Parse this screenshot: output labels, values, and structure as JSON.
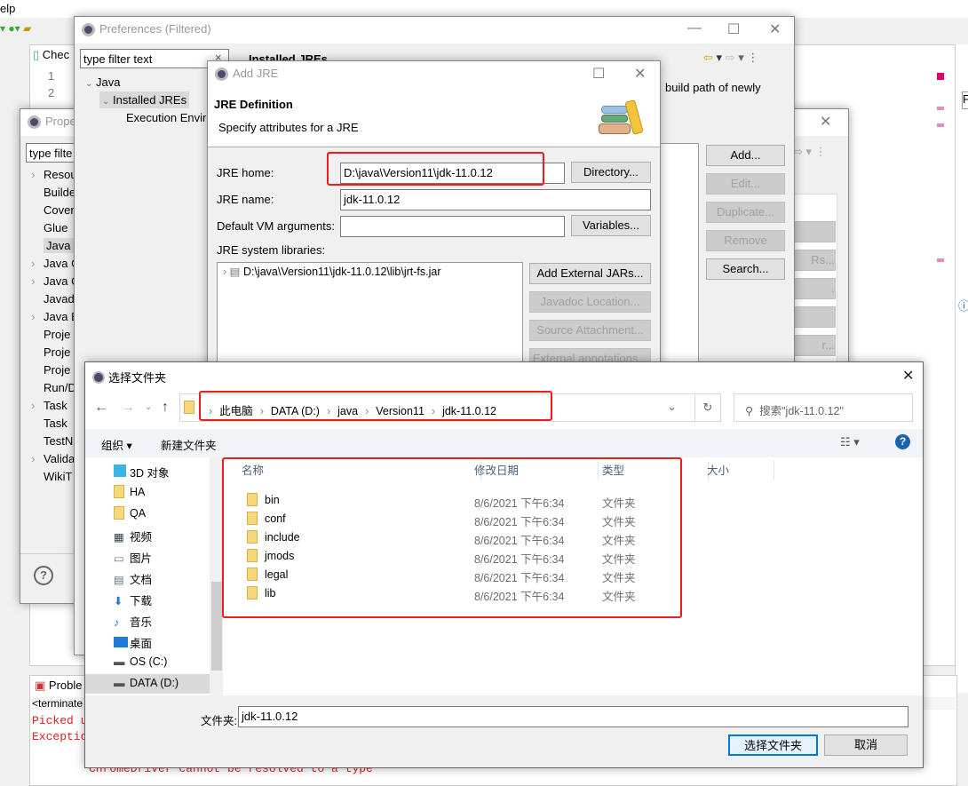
{
  "eclipse": {
    "menu_fragment": "elp",
    "editor_tab": "Chec",
    "line_numbers": [
      "1",
      "2"
    ],
    "problems_tab": "Proble",
    "console_header": "<terminate",
    "console_lines": [
      "Picked u",
      "Exceptio"
    ],
    "console_error": "ChromeDriver cannot be resolved to a type",
    "right_filter": "F"
  },
  "properties": {
    "title": "Prope",
    "filter": "type filte",
    "items": [
      {
        "label": "Resou",
        "arrow": true
      },
      {
        "label": "Builde"
      },
      {
        "label": "Cover"
      },
      {
        "label": "Glue"
      },
      {
        "label": "Java B",
        "selected": true
      },
      {
        "label": "Java C",
        "arrow": true
      },
      {
        "label": "Java C",
        "arrow": true
      },
      {
        "label": "Javad"
      },
      {
        "label": "Java E",
        "arrow": true
      },
      {
        "label": "Proje"
      },
      {
        "label": "Proje"
      },
      {
        "label": "Proje"
      },
      {
        "label": "Run/D"
      },
      {
        "label": "Task",
        "arrow": true
      },
      {
        "label": "Task"
      },
      {
        "label": "TestN"
      },
      {
        "label": "Valida",
        "arrow": true
      },
      {
        "label": "WikiT"
      }
    ],
    "right_buttons": [
      "",
      "Rs...",
      ".",
      "",
      "r..."
    ]
  },
  "preferences": {
    "title": "Preferences (Filtered)",
    "filter": "type filter text",
    "tree": {
      "java": "Java",
      "installed": "Installed JREs",
      "exec": "Execution Enviro"
    },
    "page_title": "Installed JREs",
    "description": "build path of newly",
    "buttons": {
      "add": "Add...",
      "edit": "Edit...",
      "duplicate": "Duplicate...",
      "remove": "Remove",
      "search": "Search..."
    }
  },
  "add_jre": {
    "title": "Add JRE",
    "header": "JRE Definition",
    "subheader": "Specify attributes for a JRE",
    "home_label": "JRE home:",
    "home_value": "D:\\java\\Version11\\jdk-11.0.12",
    "directory": "Directory...",
    "name_label": "JRE name:",
    "name_value": "jdk-11.0.12",
    "vm_label": "Default VM arguments:",
    "vm_value": "",
    "variables": "Variables...",
    "libs_label": "JRE system libraries:",
    "lib_item": "D:\\java\\Version11\\jdk-11.0.12\\lib\\jrt-fs.jar",
    "lib_buttons": {
      "add_ext": "Add External JARs...",
      "javadoc": "Javadoc Location...",
      "source": "Source Attachment...",
      "external": "External annotations..."
    }
  },
  "folder_dialog": {
    "title": "选择文件夹",
    "breadcrumb": [
      "此电脑",
      "DATA (D:)",
      "java",
      "Version11",
      "jdk-11.0.12"
    ],
    "search_placeholder": "搜索\"jdk-11.0.12\"",
    "organize": "组织 ▾",
    "new_folder": "新建文件夹",
    "nav": [
      {
        "label": "3D 对象",
        "icon": "cube"
      },
      {
        "label": "HA",
        "icon": "user-folder"
      },
      {
        "label": "QA",
        "icon": "folder"
      },
      {
        "label": "视频",
        "icon": "video"
      },
      {
        "label": "图片",
        "icon": "picture"
      },
      {
        "label": "文档",
        "icon": "document"
      },
      {
        "label": "下载",
        "icon": "download"
      },
      {
        "label": "音乐",
        "icon": "music"
      },
      {
        "label": "桌面",
        "icon": "desktop"
      },
      {
        "label": "OS (C:)",
        "icon": "drive"
      },
      {
        "label": "DATA (D:)",
        "icon": "drive",
        "selected": true
      }
    ],
    "columns": {
      "name": "名称",
      "date": "修改日期",
      "type": "类型",
      "size": "大小"
    },
    "files": [
      {
        "name": "bin",
        "date": "8/6/2021 下午6:34",
        "type": "文件夹"
      },
      {
        "name": "conf",
        "date": "8/6/2021 下午6:34",
        "type": "文件夹"
      },
      {
        "name": "include",
        "date": "8/6/2021 下午6:34",
        "type": "文件夹"
      },
      {
        "name": "jmods",
        "date": "8/6/2021 下午6:34",
        "type": "文件夹"
      },
      {
        "name": "legal",
        "date": "8/6/2021 下午6:34",
        "type": "文件夹"
      },
      {
        "name": "lib",
        "date": "8/6/2021 下午6:34",
        "type": "文件夹"
      }
    ],
    "folder_label": "文件夹:",
    "folder_value": "jdk-11.0.12",
    "select": "选择文件夹",
    "cancel": "取消"
  },
  "colors": {
    "highlight": "#f01c1c",
    "accent": "#0078d7",
    "error_text": "#d22222"
  }
}
